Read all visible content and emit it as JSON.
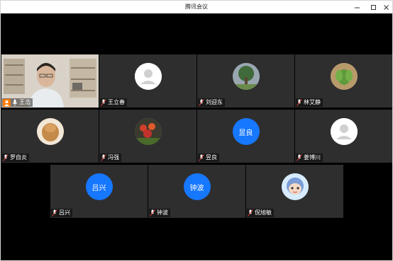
{
  "window": {
    "title": "腾讯会议",
    "controls": [
      "minimize-icon",
      "maximize-icon",
      "close-icon"
    ]
  },
  "participants": [
    {
      "name": "王浩",
      "avatar": "camera-video",
      "mic": "on",
      "host": true
    },
    {
      "name": "王立春",
      "avatar": "default-person-icon",
      "mic": "muted"
    },
    {
      "name": "刘迎东",
      "avatar": "photo-tree",
      "mic": "muted"
    },
    {
      "name": "林艾静",
      "avatar": "photo-succulent",
      "mic": "muted"
    },
    {
      "name": "罗自炎",
      "avatar": "photo-food",
      "mic": "muted"
    },
    {
      "name": "冯强",
      "avatar": "photo-flowers",
      "mic": "muted"
    },
    {
      "name": "昱良",
      "avatar_text": "昱良",
      "mic": "muted"
    },
    {
      "name": "姜博川",
      "avatar": "default-person-icon",
      "mic": "muted"
    },
    {
      "name": "吕兴",
      "avatar_text": "吕兴",
      "mic": "muted"
    },
    {
      "name": "钟波",
      "avatar_text": "钟波",
      "mic": "muted"
    },
    {
      "name": "倪旭敏",
      "avatar": "cartoon-avatar",
      "mic": "muted"
    }
  ],
  "colors": {
    "tile": "#2e2e2e",
    "stage": "#000000",
    "text_avatar": "#1677ff",
    "host_badge": "#ff7a00",
    "mic_muted": "#e0403d"
  }
}
